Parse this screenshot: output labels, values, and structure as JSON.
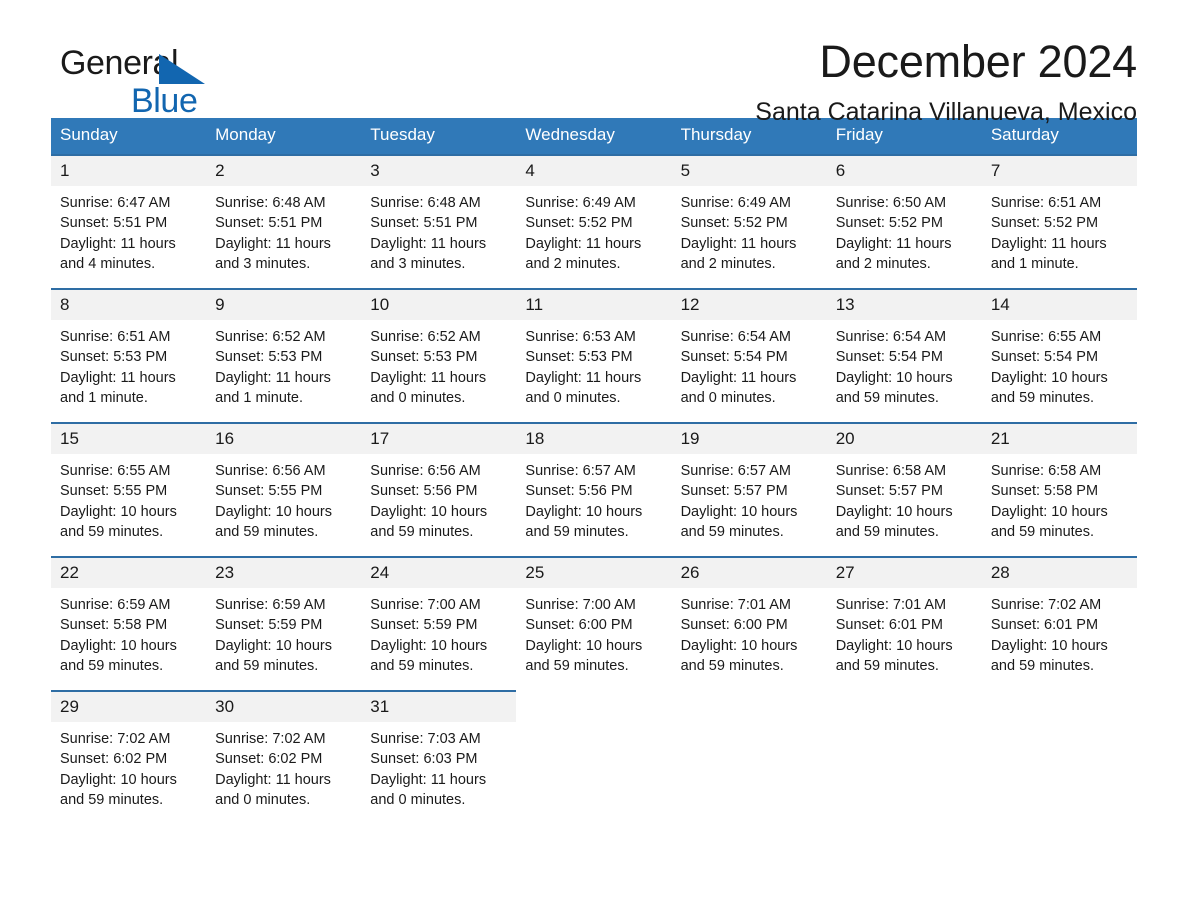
{
  "brand": {
    "name_part1": "General",
    "name_part2": "Blue",
    "triangle_color": "#1266b0"
  },
  "header": {
    "month_title": "December 2024",
    "location": "Santa Catarina Villanueva, Mexico"
  },
  "calendar": {
    "header_bg": "#3079b8",
    "row_divider": "#2e6da4",
    "daynum_bg": "#f2f2f2",
    "weekdays": [
      "Sunday",
      "Monday",
      "Tuesday",
      "Wednesday",
      "Thursday",
      "Friday",
      "Saturday"
    ],
    "weeks": [
      [
        {
          "day": "1",
          "sunrise": "Sunrise: 6:47 AM",
          "sunset": "Sunset: 5:51 PM",
          "daylight": "Daylight: 11 hours and 4 minutes."
        },
        {
          "day": "2",
          "sunrise": "Sunrise: 6:48 AM",
          "sunset": "Sunset: 5:51 PM",
          "daylight": "Daylight: 11 hours and 3 minutes."
        },
        {
          "day": "3",
          "sunrise": "Sunrise: 6:48 AM",
          "sunset": "Sunset: 5:51 PM",
          "daylight": "Daylight: 11 hours and 3 minutes."
        },
        {
          "day": "4",
          "sunrise": "Sunrise: 6:49 AM",
          "sunset": "Sunset: 5:52 PM",
          "daylight": "Daylight: 11 hours and 2 minutes."
        },
        {
          "day": "5",
          "sunrise": "Sunrise: 6:49 AM",
          "sunset": "Sunset: 5:52 PM",
          "daylight": "Daylight: 11 hours and 2 minutes."
        },
        {
          "day": "6",
          "sunrise": "Sunrise: 6:50 AM",
          "sunset": "Sunset: 5:52 PM",
          "daylight": "Daylight: 11 hours and 2 minutes."
        },
        {
          "day": "7",
          "sunrise": "Sunrise: 6:51 AM",
          "sunset": "Sunset: 5:52 PM",
          "daylight": "Daylight: 11 hours and 1 minute."
        }
      ],
      [
        {
          "day": "8",
          "sunrise": "Sunrise: 6:51 AM",
          "sunset": "Sunset: 5:53 PM",
          "daylight": "Daylight: 11 hours and 1 minute."
        },
        {
          "day": "9",
          "sunrise": "Sunrise: 6:52 AM",
          "sunset": "Sunset: 5:53 PM",
          "daylight": "Daylight: 11 hours and 1 minute."
        },
        {
          "day": "10",
          "sunrise": "Sunrise: 6:52 AM",
          "sunset": "Sunset: 5:53 PM",
          "daylight": "Daylight: 11 hours and 0 minutes."
        },
        {
          "day": "11",
          "sunrise": "Sunrise: 6:53 AM",
          "sunset": "Sunset: 5:53 PM",
          "daylight": "Daylight: 11 hours and 0 minutes."
        },
        {
          "day": "12",
          "sunrise": "Sunrise: 6:54 AM",
          "sunset": "Sunset: 5:54 PM",
          "daylight": "Daylight: 11 hours and 0 minutes."
        },
        {
          "day": "13",
          "sunrise": "Sunrise: 6:54 AM",
          "sunset": "Sunset: 5:54 PM",
          "daylight": "Daylight: 10 hours and 59 minutes."
        },
        {
          "day": "14",
          "sunrise": "Sunrise: 6:55 AM",
          "sunset": "Sunset: 5:54 PM",
          "daylight": "Daylight: 10 hours and 59 minutes."
        }
      ],
      [
        {
          "day": "15",
          "sunrise": "Sunrise: 6:55 AM",
          "sunset": "Sunset: 5:55 PM",
          "daylight": "Daylight: 10 hours and 59 minutes."
        },
        {
          "day": "16",
          "sunrise": "Sunrise: 6:56 AM",
          "sunset": "Sunset: 5:55 PM",
          "daylight": "Daylight: 10 hours and 59 minutes."
        },
        {
          "day": "17",
          "sunrise": "Sunrise: 6:56 AM",
          "sunset": "Sunset: 5:56 PM",
          "daylight": "Daylight: 10 hours and 59 minutes."
        },
        {
          "day": "18",
          "sunrise": "Sunrise: 6:57 AM",
          "sunset": "Sunset: 5:56 PM",
          "daylight": "Daylight: 10 hours and 59 minutes."
        },
        {
          "day": "19",
          "sunrise": "Sunrise: 6:57 AM",
          "sunset": "Sunset: 5:57 PM",
          "daylight": "Daylight: 10 hours and 59 minutes."
        },
        {
          "day": "20",
          "sunrise": "Sunrise: 6:58 AM",
          "sunset": "Sunset: 5:57 PM",
          "daylight": "Daylight: 10 hours and 59 minutes."
        },
        {
          "day": "21",
          "sunrise": "Sunrise: 6:58 AM",
          "sunset": "Sunset: 5:58 PM",
          "daylight": "Daylight: 10 hours and 59 minutes."
        }
      ],
      [
        {
          "day": "22",
          "sunrise": "Sunrise: 6:59 AM",
          "sunset": "Sunset: 5:58 PM",
          "daylight": "Daylight: 10 hours and 59 minutes."
        },
        {
          "day": "23",
          "sunrise": "Sunrise: 6:59 AM",
          "sunset": "Sunset: 5:59 PM",
          "daylight": "Daylight: 10 hours and 59 minutes."
        },
        {
          "day": "24",
          "sunrise": "Sunrise: 7:00 AM",
          "sunset": "Sunset: 5:59 PM",
          "daylight": "Daylight: 10 hours and 59 minutes."
        },
        {
          "day": "25",
          "sunrise": "Sunrise: 7:00 AM",
          "sunset": "Sunset: 6:00 PM",
          "daylight": "Daylight: 10 hours and 59 minutes."
        },
        {
          "day": "26",
          "sunrise": "Sunrise: 7:01 AM",
          "sunset": "Sunset: 6:00 PM",
          "daylight": "Daylight: 10 hours and 59 minutes."
        },
        {
          "day": "27",
          "sunrise": "Sunrise: 7:01 AM",
          "sunset": "Sunset: 6:01 PM",
          "daylight": "Daylight: 10 hours and 59 minutes."
        },
        {
          "day": "28",
          "sunrise": "Sunrise: 7:02 AM",
          "sunset": "Sunset: 6:01 PM",
          "daylight": "Daylight: 10 hours and 59 minutes."
        }
      ],
      [
        {
          "day": "29",
          "sunrise": "Sunrise: 7:02 AM",
          "sunset": "Sunset: 6:02 PM",
          "daylight": "Daylight: 10 hours and 59 minutes."
        },
        {
          "day": "30",
          "sunrise": "Sunrise: 7:02 AM",
          "sunset": "Sunset: 6:02 PM",
          "daylight": "Daylight: 11 hours and 0 minutes."
        },
        {
          "day": "31",
          "sunrise": "Sunrise: 7:03 AM",
          "sunset": "Sunset: 6:03 PM",
          "daylight": "Daylight: 11 hours and 0 minutes."
        },
        {
          "day": "",
          "sunrise": "",
          "sunset": "",
          "daylight": ""
        },
        {
          "day": "",
          "sunrise": "",
          "sunset": "",
          "daylight": ""
        },
        {
          "day": "",
          "sunrise": "",
          "sunset": "",
          "daylight": ""
        },
        {
          "day": "",
          "sunrise": "",
          "sunset": "",
          "daylight": ""
        }
      ]
    ]
  }
}
